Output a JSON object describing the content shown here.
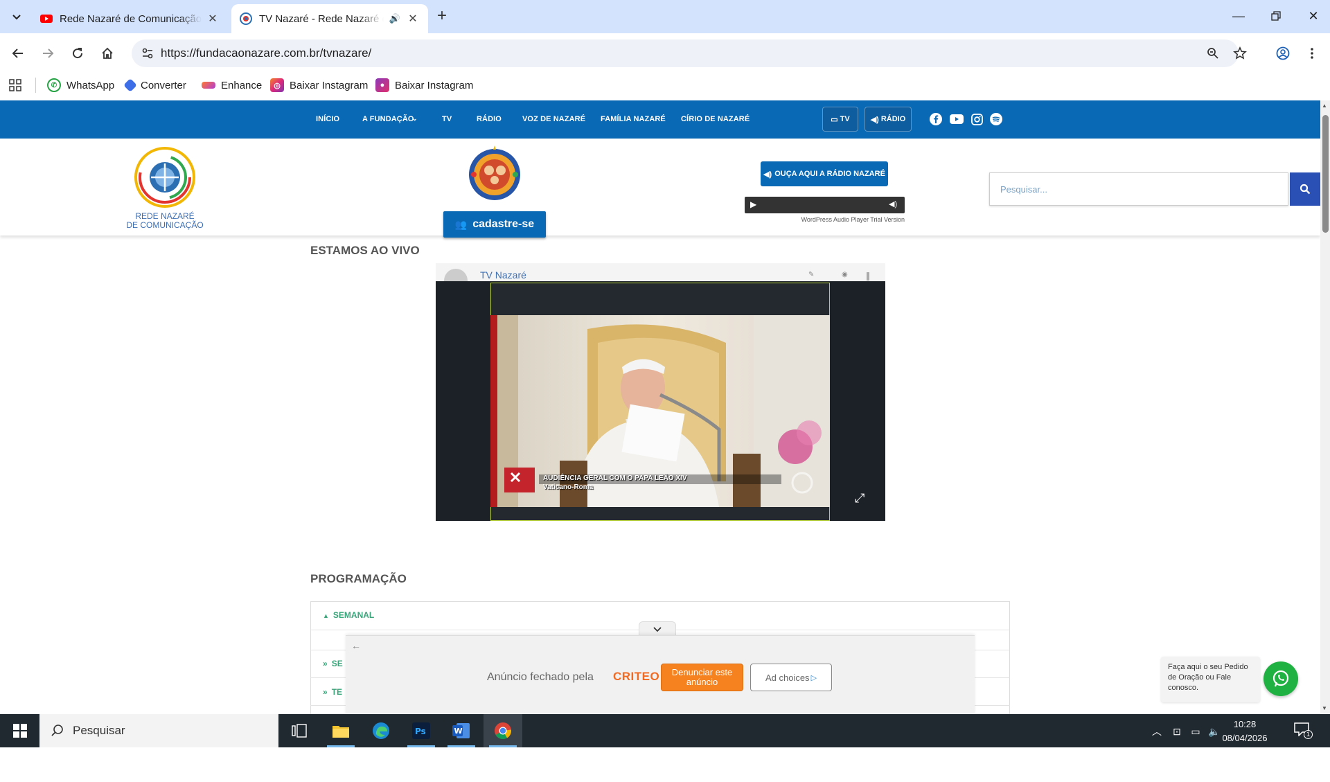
{
  "browser": {
    "tabs": [
      {
        "title": "Rede Nazaré de Comunicação - YouTube",
        "active": false,
        "favicon": "youtube-icon"
      },
      {
        "title": "TV Nazaré - Rede Nazaré de Comunicação",
        "active": true,
        "favicon": "site-icon"
      }
    ],
    "url": "https://fundacaonazare.com.br/tvnazare/",
    "bookmarks": [
      {
        "label": "WhatsApp",
        "icon": "whatsapp-icon"
      },
      {
        "label": "Converter",
        "icon": "converter-icon"
      },
      {
        "label": "Enhance",
        "icon": "enhance-icon"
      },
      {
        "label": "Baixar Instagram",
        "icon": "instagram-icon"
      },
      {
        "label": "Baixar Instagram",
        "icon": "instagram-icon-2"
      }
    ]
  },
  "site": {
    "nav": [
      "INÍCIO",
      "A FUNDAÇÃO",
      "TV",
      "RÁDIO",
      "VOZ DE NAZARÉ",
      "FAMÍLIA NAZARÉ",
      "CÍRIO DE NAZARÉ"
    ],
    "pill_tv": "TV",
    "pill_radio": "RÁDIO",
    "logo_line1": "REDE NAZARÉ",
    "logo_line2": "DE COMUNICAÇÃO",
    "cadastre": "cadastre-se",
    "radio_button": "OUÇA AQUI A RÁDIO NAZARÉ",
    "player_trial": "WordPress Audio Player Trial Version",
    "search_placeholder": "Pesquisar...",
    "live_title": "ESTAMOS AO VIVO",
    "video_channel": "TV Nazaré",
    "video_caption_1": "AUDIÊNCIA GERAL COM O PAPA LEÃO XIV",
    "video_caption_2": "Vaticano-Roma",
    "programacao_title": "PROGRAMAÇÃO",
    "accordion": [
      {
        "label": "SEMANAL",
        "expanded": true
      },
      {
        "label": "SE",
        "expanded": false
      },
      {
        "label": "TE",
        "expanded": false
      }
    ],
    "whatsapp_text": "Faça aqui o seu Pedido de Oração ou Fale conosco."
  },
  "ad": {
    "closed_text": "Anúncio fechado pela",
    "brand": "CRITEO",
    "report_label": "Denunciar este anúncio",
    "choices_label": "Ad choices"
  },
  "taskbar": {
    "search_label": "Pesquisar",
    "time": "10:28",
    "date": "08/04/2026",
    "notification_count": "1"
  },
  "colors": {
    "site_blue": "#0a69b4",
    "tab_strip": "#d3e3fd",
    "green_accent": "#3aa57a"
  }
}
